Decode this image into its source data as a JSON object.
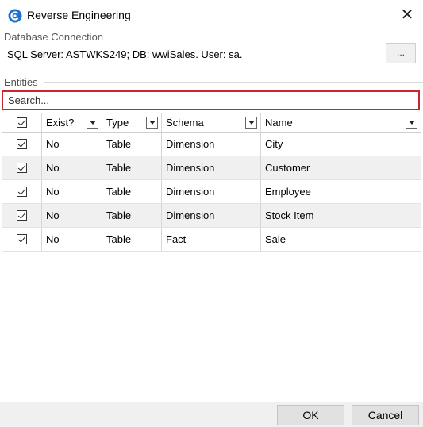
{
  "window": {
    "title": "Reverse Engineering",
    "close_glyph": "✕"
  },
  "connection": {
    "group_label": "Database Connection",
    "text": "SQL Server:  ASTWKS249; DB: wwiSales. User: sa.",
    "browse_label": "..."
  },
  "entities": {
    "group_label": "Entities",
    "search_placeholder": "Search...",
    "columns": [
      "",
      "Exist?",
      "Type",
      "Schema",
      "Name"
    ],
    "rows": [
      {
        "checked": true,
        "exist": "No",
        "type": "Table",
        "schema": "Dimension",
        "name": "City"
      },
      {
        "checked": true,
        "exist": "No",
        "type": "Table",
        "schema": "Dimension",
        "name": "Customer"
      },
      {
        "checked": true,
        "exist": "No",
        "type": "Table",
        "schema": "Dimension",
        "name": "Employee"
      },
      {
        "checked": true,
        "exist": "No",
        "type": "Table",
        "schema": "Dimension",
        "name": "Stock Item"
      },
      {
        "checked": true,
        "exist": "No",
        "type": "Table",
        "schema": "Fact",
        "name": "Sale"
      }
    ]
  },
  "footer": {
    "ok_label": "OK",
    "cancel_label": "Cancel"
  },
  "colors": {
    "accent": "#1e6fd0",
    "search_border": "#c9252e",
    "alt_row": "#f0f0f0"
  },
  "icons": {
    "app": "app-logo-icon",
    "close": "close-icon",
    "checkbox": "checkbox-checked-icon",
    "dropdown": "chevron-down-icon"
  }
}
